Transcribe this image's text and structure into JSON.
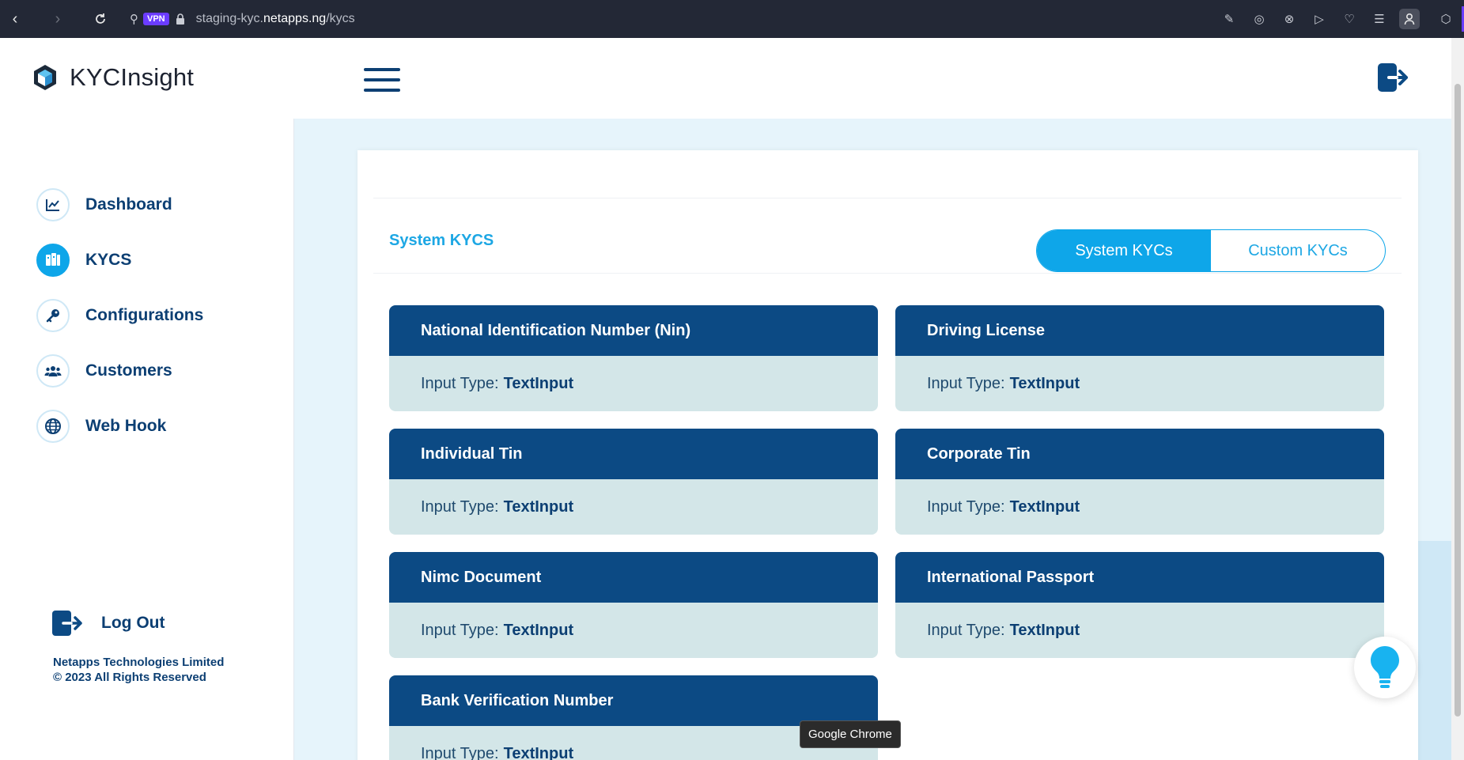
{
  "browser": {
    "vpn_label": "VPN",
    "url_prefix": "staging-kyc.",
    "url_domain": "netapps.ng",
    "url_path": "/kycs",
    "tooltip": "Google Chrome"
  },
  "header": {
    "app_title": "KYCInsight"
  },
  "sidebar": {
    "items": [
      {
        "label": "Dashboard",
        "icon": "chart-line-icon"
      },
      {
        "label": "KYCS",
        "icon": "id-cards-icon",
        "active": true
      },
      {
        "label": "Configurations",
        "icon": "key-icon"
      },
      {
        "label": "Customers",
        "icon": "users-icon"
      },
      {
        "label": "Web Hook",
        "icon": "globe-icon"
      }
    ],
    "logout_label": "Log Out",
    "footer_company": "Netapps Technologies Limited",
    "footer_rights": "© 2023 All Rights Reserved"
  },
  "main": {
    "section_title": "System KYCS",
    "tabs": [
      {
        "label": "System KYCs",
        "active": true
      },
      {
        "label": "Custom KYCs",
        "active": false
      }
    ],
    "input_type_label": "Input Type:",
    "kycs": [
      {
        "name": "National Identification Number (Nin)",
        "input_type": "TextInput"
      },
      {
        "name": "Driving License",
        "input_type": "TextInput"
      },
      {
        "name": "Individual Tin",
        "input_type": "TextInput"
      },
      {
        "name": "Corporate Tin",
        "input_type": "TextInput"
      },
      {
        "name": "Nimc Document",
        "input_type": "TextInput"
      },
      {
        "name": "International Passport",
        "input_type": "TextInput"
      },
      {
        "name": "Bank Verification Number",
        "input_type": "TextInput"
      }
    ]
  },
  "colors": {
    "primary": "#0c4a84",
    "accent": "#0ea6e9",
    "card_body": "#d3e6e8",
    "background": "#e6f4fb"
  }
}
